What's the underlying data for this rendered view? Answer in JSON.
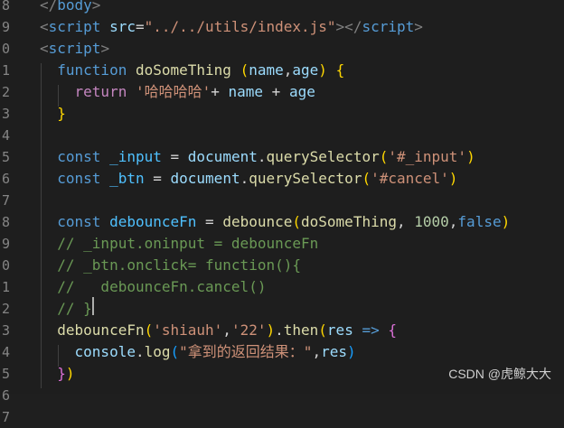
{
  "editor": {
    "line_numbers": [
      "8",
      "9",
      "0",
      "1",
      "2",
      "3",
      "4",
      "5",
      "6",
      "7",
      "8",
      "9",
      "0",
      "1",
      "2",
      "3",
      "4",
      "5",
      "6",
      "7"
    ],
    "lines": [
      [
        {
          "t": "</",
          "c": "t-punct"
        },
        {
          "t": "body",
          "c": "t-tag"
        },
        {
          "t": ">",
          "c": "t-punct"
        }
      ],
      [
        {
          "t": "<",
          "c": "t-punct"
        },
        {
          "t": "script",
          "c": "t-tag"
        },
        {
          "t": " ",
          "c": "t-plain"
        },
        {
          "t": "src",
          "c": "t-attr"
        },
        {
          "t": "=",
          "c": "t-plain"
        },
        {
          "t": "\"../../utils/index.js\"",
          "c": "t-str"
        },
        {
          "t": "></",
          "c": "t-punct"
        },
        {
          "t": "script",
          "c": "t-tag"
        },
        {
          "t": ">",
          "c": "t-punct"
        }
      ],
      [
        {
          "t": "<",
          "c": "t-punct"
        },
        {
          "t": "script",
          "c": "t-tag"
        },
        {
          "t": ">",
          "c": "t-punct"
        }
      ],
      [
        {
          "t": "  ",
          "c": "t-plain"
        },
        {
          "t": "function",
          "c": "t-kw"
        },
        {
          "t": " ",
          "c": "t-plain"
        },
        {
          "t": "doSomeThing",
          "c": "t-fn"
        },
        {
          "t": " ",
          "c": "t-plain"
        },
        {
          "t": "(",
          "c": "t-b1"
        },
        {
          "t": "name",
          "c": "t-var"
        },
        {
          "t": ",",
          "c": "t-plain"
        },
        {
          "t": "age",
          "c": "t-var"
        },
        {
          "t": ")",
          "c": "t-b1"
        },
        {
          "t": " ",
          "c": "t-plain"
        },
        {
          "t": "{",
          "c": "t-b1"
        }
      ],
      [
        {
          "t": "    ",
          "c": "t-plain"
        },
        {
          "t": "return",
          "c": "t-ctrl"
        },
        {
          "t": " ",
          "c": "t-plain"
        },
        {
          "t": "'哈哈哈哈'",
          "c": "t-str"
        },
        {
          "t": "+ ",
          "c": "t-plain"
        },
        {
          "t": "name",
          "c": "t-var"
        },
        {
          "t": " + ",
          "c": "t-plain"
        },
        {
          "t": "age",
          "c": "t-var"
        }
      ],
      [
        {
          "t": "  ",
          "c": "t-plain"
        },
        {
          "t": "}",
          "c": "t-b1"
        }
      ],
      [],
      [
        {
          "t": "  ",
          "c": "t-plain"
        },
        {
          "t": "const",
          "c": "t-kw"
        },
        {
          "t": " ",
          "c": "t-plain"
        },
        {
          "t": "_input",
          "c": "t-const"
        },
        {
          "t": " = ",
          "c": "t-plain"
        },
        {
          "t": "document",
          "c": "t-var"
        },
        {
          "t": ".",
          "c": "t-plain"
        },
        {
          "t": "querySelector",
          "c": "t-fn"
        },
        {
          "t": "(",
          "c": "t-b1"
        },
        {
          "t": "'#_input'",
          "c": "t-str"
        },
        {
          "t": ")",
          "c": "t-b1"
        }
      ],
      [
        {
          "t": "  ",
          "c": "t-plain"
        },
        {
          "t": "const",
          "c": "t-kw"
        },
        {
          "t": " ",
          "c": "t-plain"
        },
        {
          "t": "_btn",
          "c": "t-const"
        },
        {
          "t": " = ",
          "c": "t-plain"
        },
        {
          "t": "document",
          "c": "t-var"
        },
        {
          "t": ".",
          "c": "t-plain"
        },
        {
          "t": "querySelector",
          "c": "t-fn"
        },
        {
          "t": "(",
          "c": "t-b1"
        },
        {
          "t": "'#cancel'",
          "c": "t-str"
        },
        {
          "t": ")",
          "c": "t-b1"
        }
      ],
      [],
      [
        {
          "t": "  ",
          "c": "t-plain"
        },
        {
          "t": "const",
          "c": "t-kw"
        },
        {
          "t": " ",
          "c": "t-plain"
        },
        {
          "t": "debounceFn",
          "c": "t-const"
        },
        {
          "t": " = ",
          "c": "t-plain"
        },
        {
          "t": "debounce",
          "c": "t-fn"
        },
        {
          "t": "(",
          "c": "t-b1"
        },
        {
          "t": "doSomeThing",
          "c": "t-fn"
        },
        {
          "t": ", ",
          "c": "t-plain"
        },
        {
          "t": "1000",
          "c": "t-num"
        },
        {
          "t": ",",
          "c": "t-plain"
        },
        {
          "t": "false",
          "c": "t-kw"
        },
        {
          "t": ")",
          "c": "t-b1"
        }
      ],
      [
        {
          "t": "  ",
          "c": "t-plain"
        },
        {
          "t": "// _input.oninput = debounceFn",
          "c": "t-cmt"
        }
      ],
      [
        {
          "t": "  ",
          "c": "t-plain"
        },
        {
          "t": "// _btn.onclick= function(){",
          "c": "t-cmt"
        }
      ],
      [
        {
          "t": "  ",
          "c": "t-plain"
        },
        {
          "t": "//   debounceFn.cancel()",
          "c": "t-cmt"
        }
      ],
      [
        {
          "t": "  ",
          "c": "t-plain"
        },
        {
          "t": "// }",
          "c": "t-cmt"
        }
      ],
      [
        {
          "t": "  ",
          "c": "t-plain"
        },
        {
          "t": "debounceFn",
          "c": "t-fn"
        },
        {
          "t": "(",
          "c": "t-b1"
        },
        {
          "t": "'shiauh'",
          "c": "t-str"
        },
        {
          "t": ",",
          "c": "t-plain"
        },
        {
          "t": "'22'",
          "c": "t-str"
        },
        {
          "t": ")",
          "c": "t-b1"
        },
        {
          "t": ".",
          "c": "t-plain"
        },
        {
          "t": "then",
          "c": "t-fn"
        },
        {
          "t": "(",
          "c": "t-b1"
        },
        {
          "t": "res",
          "c": "t-var"
        },
        {
          "t": " ",
          "c": "t-plain"
        },
        {
          "t": "=>",
          "c": "t-kw"
        },
        {
          "t": " ",
          "c": "t-plain"
        },
        {
          "t": "{",
          "c": "t-b2"
        }
      ],
      [
        {
          "t": "    ",
          "c": "t-plain"
        },
        {
          "t": "console",
          "c": "t-var"
        },
        {
          "t": ".",
          "c": "t-plain"
        },
        {
          "t": "log",
          "c": "t-fn"
        },
        {
          "t": "(",
          "c": "t-b3"
        },
        {
          "t": "\"拿到的返回结果：\"",
          "c": "t-str"
        },
        {
          "t": ",",
          "c": "t-plain"
        },
        {
          "t": "res",
          "c": "t-var"
        },
        {
          "t": ")",
          "c": "t-b3"
        }
      ],
      [
        {
          "t": "  ",
          "c": "t-plain"
        },
        {
          "t": "}",
          "c": "t-b2"
        },
        {
          "t": ")",
          "c": "t-b1"
        }
      ],
      [],
      []
    ]
  },
  "watermark": "CSDN @虎鲸大大"
}
